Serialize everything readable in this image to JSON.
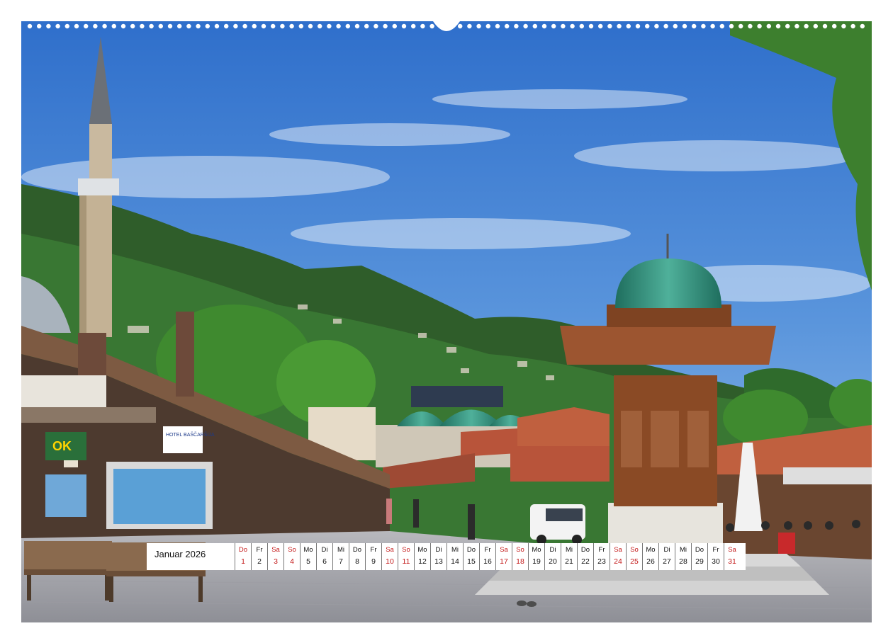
{
  "calendar": {
    "month": "Januar 2026",
    "days": [
      {
        "wd": "Do",
        "d": "1",
        "we": true
      },
      {
        "wd": "Fr",
        "d": "2",
        "we": false
      },
      {
        "wd": "Sa",
        "d": "3",
        "we": true
      },
      {
        "wd": "So",
        "d": "4",
        "we": true
      },
      {
        "wd": "Mo",
        "d": "5",
        "we": false
      },
      {
        "wd": "Di",
        "d": "6",
        "we": false
      },
      {
        "wd": "Mi",
        "d": "7",
        "we": false
      },
      {
        "wd": "Do",
        "d": "8",
        "we": false
      },
      {
        "wd": "Fr",
        "d": "9",
        "we": false
      },
      {
        "wd": "Sa",
        "d": "10",
        "we": true
      },
      {
        "wd": "So",
        "d": "11",
        "we": true
      },
      {
        "wd": "Mo",
        "d": "12",
        "we": false
      },
      {
        "wd": "Di",
        "d": "13",
        "we": false
      },
      {
        "wd": "Mi",
        "d": "14",
        "we": false
      },
      {
        "wd": "Do",
        "d": "15",
        "we": false
      },
      {
        "wd": "Fr",
        "d": "16",
        "we": false
      },
      {
        "wd": "Sa",
        "d": "17",
        "we": true
      },
      {
        "wd": "So",
        "d": "18",
        "we": true
      },
      {
        "wd": "Mo",
        "d": "19",
        "we": false
      },
      {
        "wd": "Di",
        "d": "20",
        "we": false
      },
      {
        "wd": "Mi",
        "d": "21",
        "we": false
      },
      {
        "wd": "Do",
        "d": "22",
        "we": false
      },
      {
        "wd": "Fr",
        "d": "23",
        "we": false
      },
      {
        "wd": "Sa",
        "d": "24",
        "we": true
      },
      {
        "wd": "So",
        "d": "25",
        "we": true
      },
      {
        "wd": "Mo",
        "d": "26",
        "we": false
      },
      {
        "wd": "Di",
        "d": "27",
        "we": false
      },
      {
        "wd": "Mi",
        "d": "28",
        "we": false
      },
      {
        "wd": "Do",
        "d": "29",
        "we": false
      },
      {
        "wd": "Fr",
        "d": "30",
        "we": false
      },
      {
        "wd": "Sa",
        "d": "31",
        "we": true
      }
    ]
  },
  "photo": {
    "signs": {
      "hotel": "HOTEL BAŠČARŠIJA",
      "sign_ok": "OK"
    }
  },
  "colors": {
    "sky": "#3e7bd1",
    "weekend": "#c41a1a",
    "dome": "#2e8f7a",
    "roof": "#b8543a"
  }
}
